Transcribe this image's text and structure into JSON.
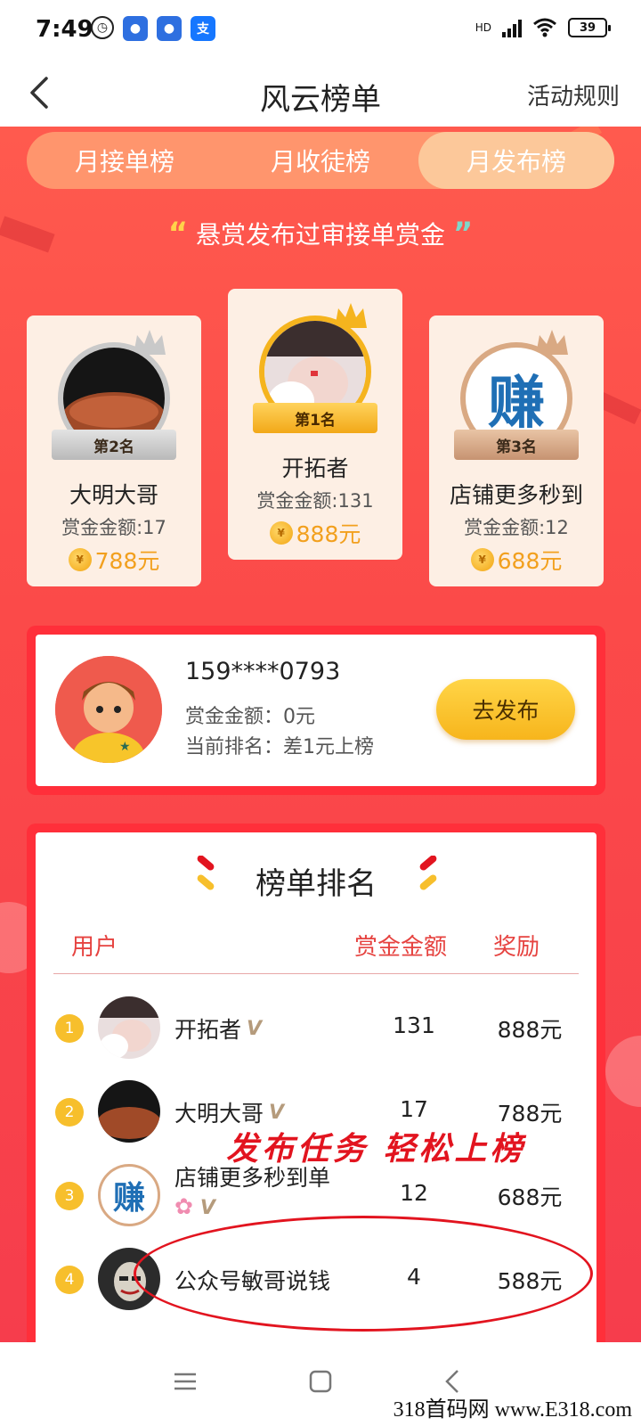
{
  "status_bar": {
    "time": "7:49",
    "network": "HD",
    "battery": "39"
  },
  "header": {
    "title": "风云榜单",
    "rules": "活动规则"
  },
  "tabs": [
    {
      "label": "月接单榜",
      "active": false
    },
    {
      "label": "月收徒榜",
      "active": false
    },
    {
      "label": "月发布榜",
      "active": true
    }
  ],
  "subtitle": "悬赏发布过审接单赏金",
  "podium": {
    "first": {
      "rank_label": "第1名",
      "name": "开拓者",
      "amount": "赏金金额:131",
      "reward": "888元"
    },
    "second": {
      "rank_label": "第2名",
      "name": "大明大哥",
      "amount": "赏金金额:17",
      "reward": "788元"
    },
    "third": {
      "rank_label": "第3名",
      "name": "店铺更多秒到",
      "amount": "赏金金额:12",
      "reward": "688元",
      "avatar_text": "赚"
    }
  },
  "me": {
    "phone": "159****0793",
    "amount": "赏金金额：0元",
    "rank": "当前排名：差1元上榜",
    "button": "去发布"
  },
  "ranking": {
    "title": "榜单排名",
    "columns": {
      "user": "用户",
      "amount": "赏金金额",
      "reward": "奖励"
    },
    "rows": [
      {
        "num": "1",
        "name": "开拓者",
        "amount": "131",
        "reward": "888元"
      },
      {
        "num": "2",
        "name": "大明大哥",
        "amount": "17",
        "reward": "788元"
      },
      {
        "num": "3",
        "name": "店铺更多秒到单",
        "amount": "12",
        "reward": "688元"
      },
      {
        "num": "4",
        "name": "公众号敏哥说钱",
        "amount": "4",
        "reward": "588元"
      }
    ]
  },
  "annotation": "发布任务 轻松上榜",
  "watermark": "318首码网 www.E318.com",
  "colors": {
    "primary_red": "#fb4a49",
    "gold": "#f7b51c",
    "annotation_red": "#e2141f"
  }
}
